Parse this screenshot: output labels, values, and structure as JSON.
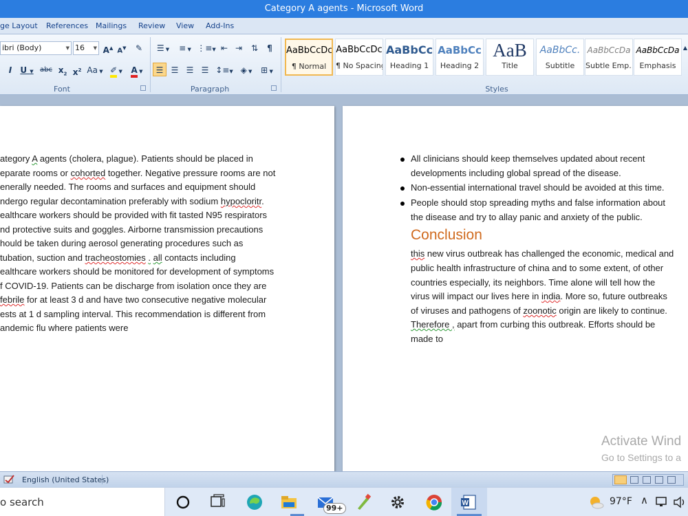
{
  "window": {
    "title": "Category A agents - Microsoft Word"
  },
  "ribbon": {
    "tabs": [
      "ge Layout",
      "References",
      "Mailings",
      "Review",
      "View",
      "Add-Ins"
    ],
    "font": {
      "name": "ibri (Body)",
      "size": "16"
    },
    "groups": {
      "font": "Font",
      "paragraph": "Paragraph",
      "styles": "Styles"
    },
    "styles": [
      {
        "sample": "AaBbCcDc",
        "name": "¶ Normal"
      },
      {
        "sample": "AaBbCcDc",
        "name": "¶ No Spacing"
      },
      {
        "sample": "AaBbCc",
        "name": "Heading 1"
      },
      {
        "sample": "AaBbCc",
        "name": "Heading 2"
      },
      {
        "sample": "AaB",
        "name": "Title"
      },
      {
        "sample": "AaBbCc.",
        "name": "Subtitle"
      },
      {
        "sample": "AaBbCcDa",
        "name": "Subtle Emp..."
      },
      {
        "sample": "AaBbCcDa",
        "name": "Emphasis"
      }
    ]
  },
  "doc": {
    "left_lines": [
      "ategory A agents (cholera, plague). Patients should be placed in",
      "eparate rooms or cohorted together. Negative pressure rooms are not",
      "enerally needed. The rooms and surfaces and equipment should",
      "ndergo regular decontamination preferably with sodium hypocloritr.",
      "ealthcare workers should be provided with fit tasted N95 respirators",
      "nd protective suits and goggles. Airborne transmission precautions",
      "hould be taken during aerosol generating procedures such as",
      "tubation, suction and tracheostomies .  all contacts including",
      "ealthcare workers should be monitored for development of symptoms",
      "f COVID-19. Patients can be discharge from isolation once they are",
      "febrile for at least 3 d and have two consecutive negative molecular",
      "ests at 1 d sampling interval. This recommendation is different from",
      "andemic flu where patients were"
    ],
    "bullets": [
      [
        "All clinicians should keep themselves updated about recent",
        "developments including global spread of the disease."
      ],
      [
        "Non-essential international travel should be avoided at this time."
      ],
      [
        "People should stop spreading myths and false information about",
        "the disease and try to allay panic and anxiety of the public."
      ]
    ],
    "conclusion_heading": "Conclusion",
    "conclusion_lines": [
      "this new virus outbreak has challenged the economic, medical and",
      "public health infrastructure  of china and to some extent, of other",
      "countries especially, its neighbors.  Time alone will tell how the",
      "virus will impact our lives here in india. More so, future outbreaks",
      "of viruses and pathogens of zoonotic origin are likely to continue.",
      "Therefore , apart from curbing this outbreak. Efforts should be",
      "made to"
    ]
  },
  "activation": {
    "line1": "Activate Wind",
    "line2": "Go to Settings to a"
  },
  "status": {
    "language": "English (United States)"
  },
  "taskbar": {
    "search": "o search",
    "badge": "99+",
    "temperature": "97°F"
  }
}
